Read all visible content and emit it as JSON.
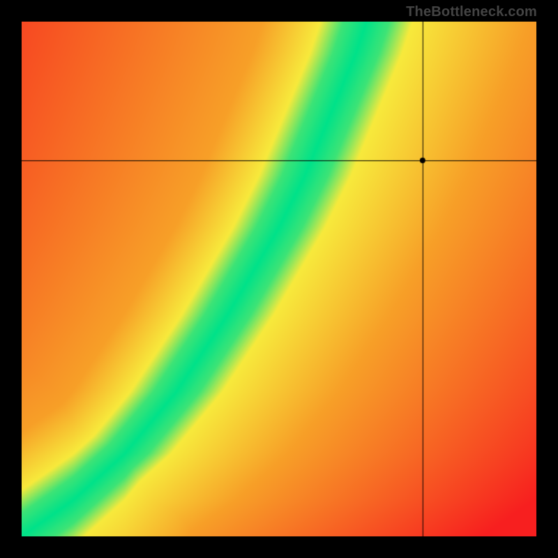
{
  "watermark": "TheBottleneck.com",
  "chart_data": {
    "type": "heatmap",
    "title": "",
    "xlabel": "",
    "ylabel": "",
    "x_range": [
      0,
      1
    ],
    "y_range": [
      0,
      1
    ],
    "marker": {
      "x": 0.78,
      "y": 0.73,
      "radius": 4
    },
    "crosshair": {
      "x": 0.78,
      "y": 0.73
    },
    "optimal_curve_description": "Green ridge running from bottom-left corner along a slightly super-linear diagonal toward top edge at x≈0.67; color fades through yellow/orange to red with distance from ridge.",
    "colors": {
      "ridge": "#00e28a",
      "near": "#f8ea3c",
      "mid": "#f7a028",
      "far": "#f71f1f",
      "top_right_far": "#f7a028"
    },
    "ridge_samples": [
      {
        "x": 0.0,
        "y": 0.0
      },
      {
        "x": 0.1,
        "y": 0.07
      },
      {
        "x": 0.2,
        "y": 0.16
      },
      {
        "x": 0.3,
        "y": 0.28
      },
      {
        "x": 0.4,
        "y": 0.43
      },
      {
        "x": 0.5,
        "y": 0.6
      },
      {
        "x": 0.55,
        "y": 0.7
      },
      {
        "x": 0.6,
        "y": 0.82
      },
      {
        "x": 0.65,
        "y": 0.94
      },
      {
        "x": 0.67,
        "y": 1.0
      }
    ],
    "ridge_halfwidth": 0.045
  }
}
